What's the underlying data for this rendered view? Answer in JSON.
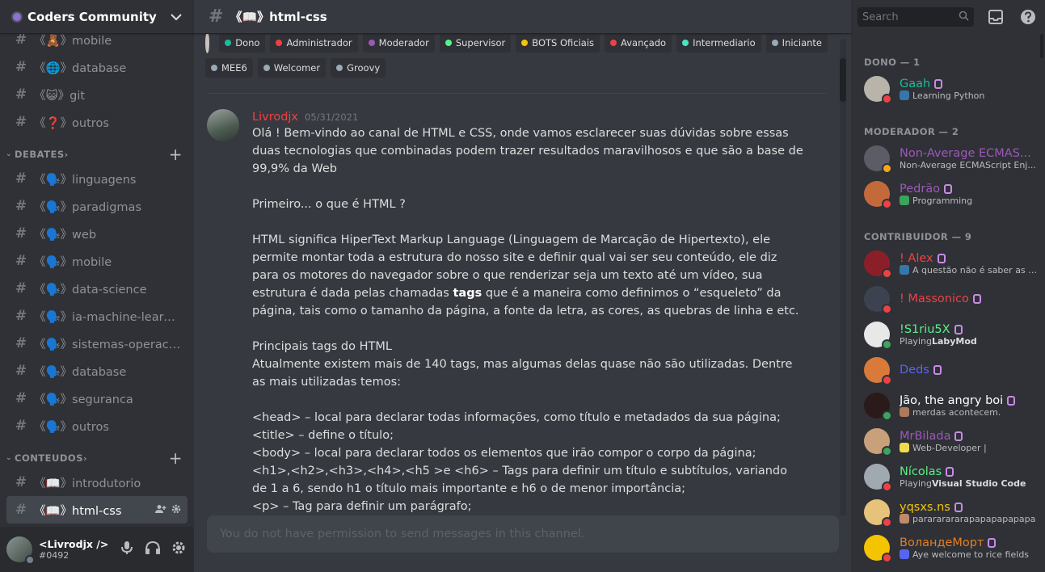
{
  "server": {
    "name": "Coders Community"
  },
  "channels_top": [
    {
      "name": "《🧸》mobile"
    },
    {
      "name": "《🌐》database"
    },
    {
      "name": "《😺》git"
    },
    {
      "name": "《❓》outros"
    }
  ],
  "categories": [
    {
      "label": "DEBATES",
      "channels": [
        {
          "name": "《🗣️》linguagens"
        },
        {
          "name": "《🗣️》paradigmas"
        },
        {
          "name": "《🗣️》web"
        },
        {
          "name": "《🗣️》mobile"
        },
        {
          "name": "《🗣️》data-science"
        },
        {
          "name": "《🗣️》ia-machine-learni..."
        },
        {
          "name": "《🗣️》sistemas-operaci..."
        },
        {
          "name": "《🗣️》database"
        },
        {
          "name": "《🗣️》seguranca"
        },
        {
          "name": "《🗣️》outros"
        }
      ]
    },
    {
      "label": "CONTEUDOS",
      "channels": [
        {
          "name": "《📖》introdutorio"
        },
        {
          "name": "《📖》html-css"
        }
      ]
    }
  ],
  "user": {
    "name": "<Livrodjx />",
    "tag": "#0492"
  },
  "channel": {
    "title": "《📖》html-css"
  },
  "search": {
    "placeholder": "Search"
  },
  "roles": [
    [
      {
        "label": "Dono",
        "color": "#1abc9c"
      },
      {
        "label": "Administrador",
        "color": "#ed4245"
      },
      {
        "label": "Moderador",
        "color": "#9b59b6"
      },
      {
        "label": "Supervisor",
        "color": "#57f287"
      },
      {
        "label": "BOTS Oficiais",
        "color": "#f1c40f"
      },
      {
        "label": "Avançado",
        "color": "#ed4245"
      },
      {
        "label": "Intermediario",
        "color": "#48e5c2"
      },
      {
        "label": "Iniciante",
        "color": "#99aab5"
      }
    ],
    [
      {
        "label": "MEE6",
        "color": "#99aab5"
      },
      {
        "label": "Welcomer",
        "color": "#99aab5"
      },
      {
        "label": "Groovy",
        "color": "#99aab5"
      }
    ]
  ],
  "message": {
    "author": "Livrodjx",
    "timestamp": "05/31/2021",
    "paragraphs": [
      "Olá ! Bem-vindo ao canal de HTML e CSS, onde vamos esclarecer suas dúvidas sobre essas duas tecnologias que combinadas podem trazer resultados maravilhosos e que são a base de 99,9% da Web",
      "",
      "Primeiro... o que é HTML ?",
      "",
      "HTML significa HiperText Markup Language (Linguagem de Marcação de Hipertexto), ele permite montar toda a estrutura do nosso site e definir qual vai ser seu conteúdo, ele diz para os motores do navegador sobre o que renderizar seja um texto até um vídeo, sua estrutura é dada pelas chamadas",
      "",
      "Principais tags do HTML",
      "Atualmente existem mais de 140 tags, mas algumas delas quase não são utilizadas. Dentre as mais utilizadas temos:",
      "",
      "<head> – local para declarar todas informações, como título e metadados da sua página;",
      "<title> – define o título;",
      "<body> – local para declarar todos os elementos que irão compor o corpo da página;",
      "<h1>,<h2>,<h3>,<h4>,<h5 >e <h6> – Tags para definir um título e subtítulos, variando de 1 a 6, sendo h1 o título mais importante e h6 o de menor importância;",
      "<p> – Tag para definir um parágrafo;"
    ],
    "bold_word": "tags",
    "after_bold": " que é a maneira como definimos o “esqueleto” da  página,  tais como o tamanho da página, a fonte da letra, as cores, as quebras de linha e etc."
  },
  "composer": {
    "placeholder": "You do not have permission to send messages in this channel."
  },
  "member_sections": [
    {
      "label": "DONO — 1",
      "members": [
        {
          "name": "Gaah",
          "color": "#1abc9c",
          "status": "Learning Python",
          "status_prefix": "",
          "presence": "#ed4245",
          "avatar": "#b9b4aa",
          "icon": "#3776ab"
        }
      ]
    },
    {
      "label": "MODERADOR — 2",
      "members": [
        {
          "name": "Non-Average ECMAS...",
          "color": "#9b59b6",
          "status": "Non-Average ECMAScript Enj...",
          "status_prefix": "",
          "presence": "#faa61a",
          "avatar": "#5c5c66",
          "icon": ""
        },
        {
          "name": "Pedrão",
          "color": "#9b59b6",
          "status": "Programming",
          "status_prefix": "",
          "presence": "#ed4245",
          "avatar": "#c46a3a",
          "icon": "#3ba55d"
        }
      ]
    },
    {
      "label": "CONTRIBUIDOR — 9",
      "members": [
        {
          "name": "! Alex",
          "color": "#ed4245",
          "status": "A questão não é saber as li...",
          "status_prefix": "",
          "presence": "#ed4245",
          "avatar": "#8a1f2a",
          "icon": "#3776ab"
        },
        {
          "name": "! Massonico",
          "color": "#ed4245",
          "status": "",
          "status_prefix": "",
          "presence": "#ed4245",
          "avatar": "#3d4250",
          "icon": ""
        },
        {
          "name": "!S1riu5X",
          "color": "#57f287",
          "status": "LabyMod",
          "status_prefix": "Playing ",
          "presence": "#3ba55d",
          "avatar": "#e8e8e8",
          "icon": ""
        },
        {
          "name": "Deds",
          "color": "#5865f2",
          "status": "",
          "status_prefix": "",
          "presence": "#ed4245",
          "avatar": "#d97a3a",
          "icon": ""
        },
        {
          "name": "Jão, the angry boi",
          "color": "#ffffff",
          "status": "merdas acontecem.",
          "status_prefix": "",
          "presence": "#3ba55d",
          "avatar": "#2a1a1a",
          "icon": "#b07a5a"
        },
        {
          "name": "MrBilada",
          "color": "#9b59b6",
          "status": "Web-Developer |",
          "status_prefix": "",
          "presence": "#3ba55d",
          "avatar": "#c8a07a",
          "icon": "#f0db4f"
        },
        {
          "name": "Nícolas",
          "color": "#57f287",
          "status": "Visual Studio Code",
          "status_prefix": "Playing ",
          "presence": "#ed4245",
          "avatar": "#a0a8b0",
          "icon": ""
        },
        {
          "name": "yqsxs.ns",
          "color": "#f1c40f",
          "status": "parararararapapapapapapa",
          "status_prefix": "",
          "presence": "#ed4245",
          "avatar": "#e6c27a",
          "icon": "#c08a6a"
        },
        {
          "name": "ВоландеМорт",
          "color": "#e67e22",
          "status": "Aye welcome to rice fields",
          "status_prefix": "",
          "presence": "#ed4245",
          "avatar": "#f5c400",
          "icon": "#5865f2"
        }
      ]
    }
  ]
}
